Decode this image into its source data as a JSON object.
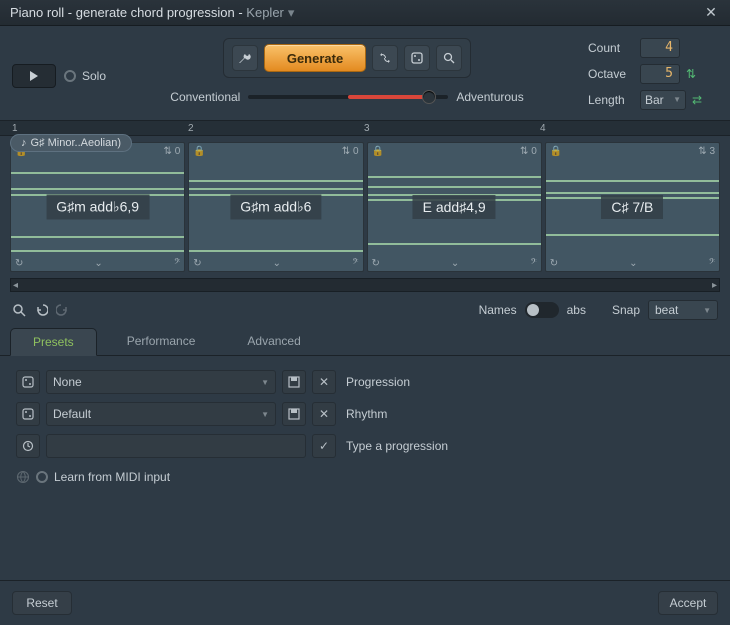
{
  "titlebar": {
    "title_prefix": "Piano roll - generate chord progression - ",
    "preset_name": "Kepler"
  },
  "top": {
    "solo_label": "Solo",
    "generate_label": "Generate",
    "slider_left": "Conventional",
    "slider_right": "Adventurous"
  },
  "params": {
    "count_label": "Count",
    "count_value": "4",
    "octave_label": "Octave",
    "octave_value": "5",
    "length_label": "Length",
    "length_value": "Bar"
  },
  "ruler": [
    "1",
    "2",
    "3",
    "4"
  ],
  "key_display": "G♯ Minor..Aeolian)",
  "chords": [
    {
      "name": "G♯m add♭6,9",
      "inv": "0"
    },
    {
      "name": "G♯m add♭6",
      "inv": "0"
    },
    {
      "name": "E add♯4,9",
      "inv": "0"
    },
    {
      "name": "C♯ 7/B",
      "inv": "3"
    }
  ],
  "mid": {
    "names_label": "Names",
    "abs_label": "abs",
    "snap_label": "Snap",
    "snap_value": "beat"
  },
  "tabs": {
    "t0": "Presets",
    "t1": "Performance",
    "t2": "Advanced"
  },
  "presets": {
    "progression_value": "None",
    "progression_label": "Progression",
    "rhythm_value": "Default",
    "rhythm_label": "Rhythm",
    "type_label": "Type a progression",
    "learn_label": "Learn from MIDI input"
  },
  "footer": {
    "reset": "Reset",
    "accept": "Accept"
  }
}
